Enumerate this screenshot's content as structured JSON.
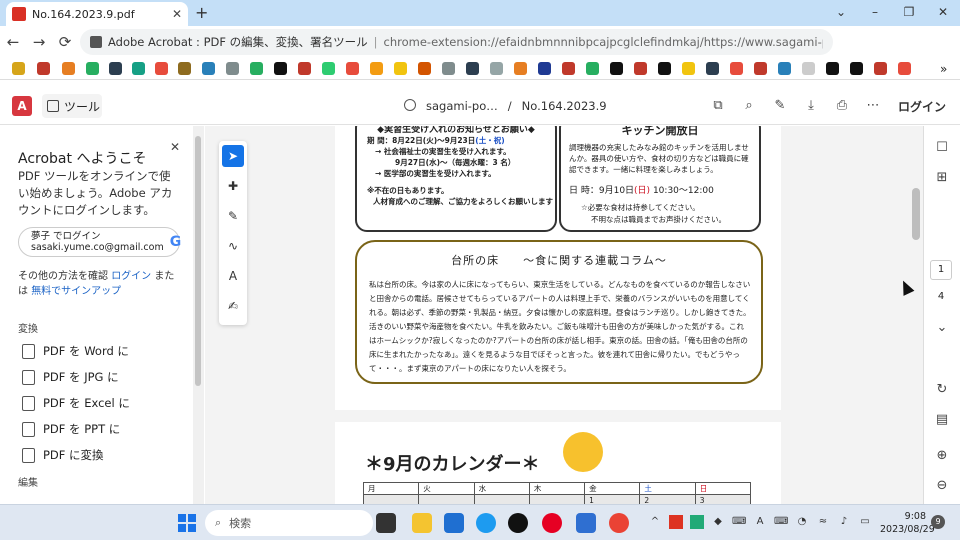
{
  "browser": {
    "tab_title": "No.164.2023.9.pdf",
    "new_tab_icon": "+",
    "window_controls": [
      "⌄",
      "–",
      "❐",
      "✕"
    ],
    "address_site": "Adobe Acrobat : PDF の編集、変換、署名ツール",
    "address_sep": "|",
    "address_url": "chrome-extension://efaidnbmnnnibpcajpcglclefindmkaj/https://www.sagami-portal.com/h..."
  },
  "acrobat": {
    "tools_label": "ツール",
    "breadcrumb_site": "sagami-po…",
    "breadcrumb_sep": "/",
    "breadcrumb_file": "No.164.2023.9",
    "login_label": "ログイン"
  },
  "left_panel": {
    "title": "Acrobat へようこそ",
    "description": "PDF ツールをオンラインで使い始めましょう。Adobe アカウントにログインします。",
    "account_line1": "夢子 でログイン",
    "account_line2": "sasaki.yume.co@gmail.com",
    "other_prefix": "その他の方法を確認 ",
    "other_login": "ログイン",
    "other_mid": " または ",
    "other_signup": "無料でサインアップ",
    "section_convert": "変換",
    "items": [
      {
        "label": "PDF を Word に"
      },
      {
        "label": "PDF を JPG に"
      },
      {
        "label": "PDF を Excel に"
      },
      {
        "label": "PDF を PPT に"
      },
      {
        "label": "PDF に変換"
      }
    ],
    "section_edit": "編集"
  },
  "document": {
    "box1": {
      "heading": "◆実習生受け入れのお知らせとお願い◆",
      "line1_pre": "期 間：8月22日(火)〜9月23日",
      "line1_tag": "(土・祝)",
      "line2": "→ 社会福祉士の実習生を受け入れます。",
      "line3": "9月27日(水)〜（毎週水曜：3 名）",
      "line4": "→ 医学部の実習生を受け入れます。",
      "line5": "※不在の日もあります。",
      "line6": "人材育成へのご理解、ご協力をよろしくお願いします"
    },
    "box2": {
      "heading": "キッチン開放日",
      "body": "調理機器の充実したみなみ館のキッチンを活用しませんか。器具の使い方や、食材の切り方などは職員に確認できます。一緒に料理を楽しみましょう。",
      "time_pre": "日 時：9月10日",
      "time_day": "(日)",
      "time_post": "10:30〜12:00",
      "note1": "☆必要な食材は持参してください。",
      "note2": "不明な点は職員までお声掛けください。"
    },
    "column": {
      "title": "台所の床　　〜食に関する連載コラム〜",
      "body": "私は台所の床。今は家の人に床になってもらい、東京生活をしている。どんなものを食べているのか報告しなさいと田舎からの電話。居候させてもらっているアパートの人は料理上手で、栄養のバランスがいいものを用意してくれる。朝は必ず、季節の野菜・乳製品・納豆。夕食は懐かしの家庭料理。昼食はランチ巡り。しかし飽きてきた。活きのいい野菜や海産物を食べたい。牛乳を飲みたい。ご飯も味噌汁も田舎の方が美味しかった気がする。これはホームシックか?寂しくなったのか?アパートの台所の床が話し相手。東京の話。田舎の話。「俺も田舎の台所の床に生まれたかったなあ」。遠くを見るような目でぼそっと言った。彼を連れて田舎に帰りたい。でもどうやって・・・。まず東京のアパートの床になりたい人を探そう。"
    },
    "calendar": {
      "title": "＊9月のカレンダー＊",
      "headers": [
        "月",
        "火",
        "水",
        "木",
        "金",
        "土",
        "日"
      ],
      "row1": [
        "",
        "",
        "",
        "",
        "1",
        "2",
        "3"
      ]
    }
  },
  "right_rail": {
    "page_current": "1",
    "page_total": "4"
  },
  "taskbar": {
    "search_placeholder": "検索",
    "time": "9:08",
    "date": "2023/08/29",
    "notifications": "9"
  },
  "colors": {
    "tabbar": "#c4dff7",
    "accent": "#1473e6",
    "adobe_red": "#d7373f",
    "column_border": "#7a6418"
  }
}
